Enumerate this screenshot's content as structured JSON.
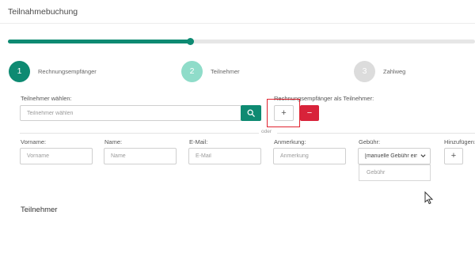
{
  "page": {
    "title": "Teilnahmebuchung"
  },
  "progress": {
    "percent": 39
  },
  "steps": [
    {
      "number": "1",
      "label": "Rechnungsempfänger",
      "state": "active",
      "color": "#0e8a72"
    },
    {
      "number": "2",
      "label": "Teilnehmer",
      "state": "current",
      "color": "#8fdcc9"
    },
    {
      "number": "3",
      "label": "Zahlweg",
      "state": "inactive",
      "color": "#dcdcdc"
    }
  ],
  "participant_select": {
    "label": "Teilnehmer wählen:",
    "placeholder": "Teilnehmer wählen",
    "search_icon": "search-icon"
  },
  "recipient_as_participant": {
    "label": "Rechnungsempfänger als Teilnehmer:",
    "add_symbol": "+",
    "remove_symbol": "−",
    "highlight_color": "#e0232f",
    "remove_color": "#d8233a"
  },
  "divider": {
    "text": "oder"
  },
  "fields": {
    "vorname": {
      "label": "Vorname:",
      "placeholder": "Vorname"
    },
    "name": {
      "label": "Name:",
      "placeholder": "Name"
    },
    "email": {
      "label": "E-Mail:",
      "placeholder": "E-Mail"
    },
    "anmerkung": {
      "label": "Anmerkung:",
      "placeholder": "Anmerkung"
    },
    "gebuehr": {
      "label": "Gebühr:",
      "selected": "[manuelle Gebühr ein",
      "dropdown_option": "Gebühr"
    },
    "hinzufuegen": {
      "label": "Hinzufügen:",
      "symbol": "+"
    }
  },
  "section": {
    "title": "Teilnehmer"
  },
  "colors": {
    "accent": "#0e8a72",
    "danger": "#d8233a"
  }
}
